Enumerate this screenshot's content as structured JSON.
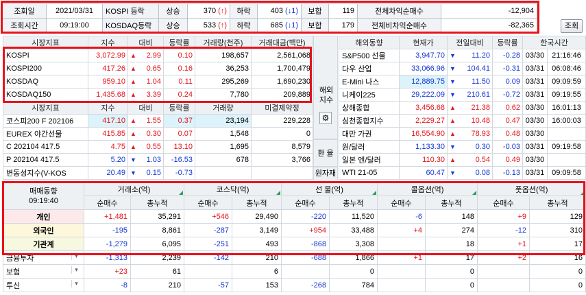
{
  "top": {
    "date_label": "조회일",
    "date_value": "2021/03/31",
    "time_label": "조회시간",
    "time_value": "09:19:00",
    "rows": [
      {
        "market": "KOSPI 등락",
        "up_label": "상승",
        "up": "370",
        "up_arrow": "(↑",
        "up_count": ")",
        "down_label": "하락",
        "down": "403",
        "down_arrow": "(↓",
        "down_count": "1)",
        "flat_label": "보합",
        "flat": "119",
        "net_label": "전체차익순매수",
        "net": "-12,904"
      },
      {
        "market": "KOSDAQ등락",
        "up_label": "상승",
        "up": "533",
        "up_arrow": "(↑",
        "up_count": ")",
        "down_label": "하락",
        "down": "685",
        "down_arrow": "(↓",
        "down_count": "1)",
        "flat_label": "보합",
        "flat": "179",
        "net_label": "전체비차익순매수",
        "net": "-82,365"
      }
    ],
    "query_button": "조회"
  },
  "market": {
    "headers": [
      "시장지표",
      "지수",
      "대비",
      "등락률",
      "거래량(천주)",
      "거래대금(백만)"
    ],
    "rows": [
      {
        "name": "KOSPI",
        "index": "3,072.99",
        "dir": "up",
        "change": "2.99",
        "rate": "0.10",
        "volume": "198,657",
        "amount": "2,561,068"
      },
      {
        "name": "KOSPI200",
        "index": "417.26",
        "dir": "up",
        "change": "0.65",
        "rate": "0.16",
        "volume": "36,253",
        "amount": "1,700,479"
      },
      {
        "name": "KOSDAQ",
        "index": "959.10",
        "dir": "up",
        "change": "1.04",
        "rate": "0.11",
        "volume": "295,269",
        "amount": "1,690,230"
      },
      {
        "name": "KOSDAQ150",
        "index": "1,435.68",
        "dir": "up",
        "change": "3.39",
        "rate": "0.24",
        "volume": "7,780",
        "amount": "209,889"
      }
    ],
    "headers2": [
      "시장지표",
      "지수",
      "대비",
      "등락률",
      "거래량",
      "미결제약정"
    ],
    "rows2": [
      {
        "name": "코스피200 F 202106",
        "index": "417.10",
        "dir": "up",
        "change": "1.55",
        "rate": "0.37",
        "volume": "23,194",
        "amount": "229,228",
        "cyan": true
      },
      {
        "name": "EUREX 야간선물",
        "index": "415.85",
        "dir": "up",
        "change": "0.30",
        "rate": "0.07",
        "volume": "1,548",
        "amount": "0",
        "cyan": false
      },
      {
        "name": "C 202104 417.5",
        "index": "4.75",
        "dir": "up",
        "change": "0.55",
        "rate": "13.10",
        "volume": "1,695",
        "amount": "8,579",
        "cyan": false
      },
      {
        "name": "P 202104 417.5",
        "index": "5.20",
        "dir": "dn",
        "change": "1.03",
        "rate": "-16.53",
        "volume": "678",
        "amount": "3,766",
        "cyan": false
      },
      {
        "name": "변동성지수(V-KOS",
        "index": "20.49",
        "dir": "dn",
        "change": "0.15",
        "rate": "-0.73",
        "volume": "",
        "amount": "",
        "cyan": false
      }
    ]
  },
  "side": {
    "overseas_label": "해외지수",
    "fx_label": "환 율",
    "commodity_label": "원자재"
  },
  "overseas": {
    "headers": [
      "해외동향",
      "현재가",
      "전일대비",
      "등락률",
      "한국시간"
    ],
    "rows": [
      {
        "name": "S&P500 선물",
        "price": "3,947.70",
        "dir": "dn",
        "change": "11.20",
        "rate": "-0.28",
        "date": "03/30",
        "time": "21:16:46",
        "cyan": false
      },
      {
        "name": "다우 산업",
        "price": "33,066.96",
        "dir": "dn",
        "change": "104.41",
        "rate": "-0.31",
        "date": "03/31",
        "time": "06:08:46",
        "cyan": false
      },
      {
        "name": "E-Mini 나스",
        "price": "12,889.75",
        "dir": "dn",
        "change": "11.50",
        "rate": "0.09",
        "date": "03/31",
        "time": "09:09:59",
        "cyan": true
      },
      {
        "name": "니케이225",
        "price": "29,222.09",
        "dir": "dn",
        "change": "210.61",
        "rate": "-0.72",
        "date": "03/31",
        "time": "09:19:55",
        "cyan": false
      },
      {
        "name": "상해종합",
        "price": "3,456.68",
        "dir": "up",
        "change": "21.38",
        "rate": "0.62",
        "date": "03/30",
        "time": "16:01:13",
        "cyan": false
      },
      {
        "name": "심천종합지수",
        "price": "2,229.27",
        "dir": "up",
        "change": "10.48",
        "rate": "0.47",
        "date": "03/30",
        "time": "16:00:03",
        "cyan": false
      },
      {
        "name": "대만 가권",
        "price": "16,554.90",
        "dir": "up",
        "change": "78.93",
        "rate": "0.48",
        "date": "03/30",
        "time": "",
        "cyan": false
      },
      {
        "name": "원/달러",
        "price": "1,133.30",
        "dir": "dn",
        "change": "0.30",
        "rate": "-0.03",
        "date": "03/31",
        "time": "09:19:58",
        "cyan": false
      },
      {
        "name": "일본 엔/달러",
        "price": "110.30",
        "dir": "up",
        "change": "0.54",
        "rate": "0.49",
        "date": "03/30",
        "time": "",
        "cyan": false
      },
      {
        "name": "WTI 21-05",
        "price": "60.47",
        "dir": "dn",
        "change": "0.08",
        "rate": "-0.13",
        "date": "03/31",
        "time": "09:09:58",
        "cyan": false
      }
    ]
  },
  "trading": {
    "title": "매매동향",
    "time": "09:19:40",
    "groups": [
      "거래소(억)",
      "코스닥(억)",
      "선 물(억)",
      "콜옵션(억)",
      "풋옵션(억)"
    ],
    "sub": [
      "순매수",
      "총누적"
    ],
    "rows": [
      {
        "name": "개인",
        "cls": "r-indiv",
        "vals": [
          "+1,481",
          "35,291",
          "+546",
          "29,490",
          "-220",
          "11,520",
          "-6",
          "148",
          "+9",
          "129"
        ]
      },
      {
        "name": "외국인",
        "cls": "r-foreign",
        "vals": [
          "-195",
          "8,861",
          "-287",
          "3,149",
          "+954",
          "33,488",
          "+4",
          "274",
          "-12",
          "310"
        ]
      },
      {
        "name": "기관계",
        "cls": "r-inst",
        "vals": [
          "-1,279",
          "6,095",
          "-251",
          "493",
          "-868",
          "3,308",
          "",
          "18",
          "+1",
          "17"
        ]
      },
      {
        "name": "금융투자",
        "cls": "r-sel",
        "vals": [
          "-1,313",
          "2,239",
          "-142",
          "210",
          "-688",
          "1,866",
          "+1",
          "17",
          "+2",
          "16"
        ]
      },
      {
        "name": "보험",
        "cls": "r-sel",
        "vals": [
          "+23",
          "61",
          "",
          "6",
          "",
          "0",
          "",
          "0",
          "",
          "0"
        ]
      },
      {
        "name": "투신",
        "cls": "r-sel",
        "vals": [
          "-8",
          "210",
          "-57",
          "153",
          "-268",
          "784",
          "",
          "0",
          "",
          "0"
        ]
      }
    ]
  },
  "icons": {
    "settings": "gear-icon",
    "dropdown": "chevron-down-icon"
  }
}
